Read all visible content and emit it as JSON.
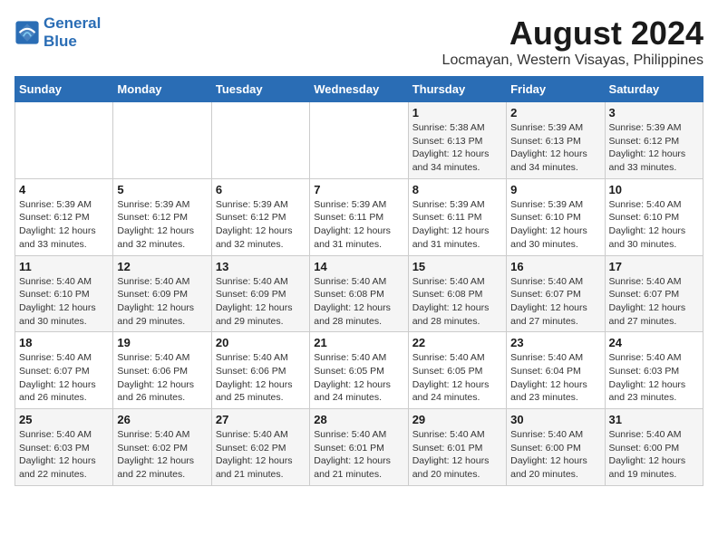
{
  "logo": {
    "line1": "General",
    "line2": "Blue"
  },
  "title": "August 2024",
  "subtitle": "Locmayan, Western Visayas, Philippines",
  "days_of_week": [
    "Sunday",
    "Monday",
    "Tuesday",
    "Wednesday",
    "Thursday",
    "Friday",
    "Saturday"
  ],
  "weeks": [
    [
      {
        "day": "",
        "info": ""
      },
      {
        "day": "",
        "info": ""
      },
      {
        "day": "",
        "info": ""
      },
      {
        "day": "",
        "info": ""
      },
      {
        "day": "1",
        "info": "Sunrise: 5:38 AM\nSunset: 6:13 PM\nDaylight: 12 hours\nand 34 minutes."
      },
      {
        "day": "2",
        "info": "Sunrise: 5:39 AM\nSunset: 6:13 PM\nDaylight: 12 hours\nand 34 minutes."
      },
      {
        "day": "3",
        "info": "Sunrise: 5:39 AM\nSunset: 6:12 PM\nDaylight: 12 hours\nand 33 minutes."
      }
    ],
    [
      {
        "day": "4",
        "info": "Sunrise: 5:39 AM\nSunset: 6:12 PM\nDaylight: 12 hours\nand 33 minutes."
      },
      {
        "day": "5",
        "info": "Sunrise: 5:39 AM\nSunset: 6:12 PM\nDaylight: 12 hours\nand 32 minutes."
      },
      {
        "day": "6",
        "info": "Sunrise: 5:39 AM\nSunset: 6:12 PM\nDaylight: 12 hours\nand 32 minutes."
      },
      {
        "day": "7",
        "info": "Sunrise: 5:39 AM\nSunset: 6:11 PM\nDaylight: 12 hours\nand 31 minutes."
      },
      {
        "day": "8",
        "info": "Sunrise: 5:39 AM\nSunset: 6:11 PM\nDaylight: 12 hours\nand 31 minutes."
      },
      {
        "day": "9",
        "info": "Sunrise: 5:39 AM\nSunset: 6:10 PM\nDaylight: 12 hours\nand 30 minutes."
      },
      {
        "day": "10",
        "info": "Sunrise: 5:40 AM\nSunset: 6:10 PM\nDaylight: 12 hours\nand 30 minutes."
      }
    ],
    [
      {
        "day": "11",
        "info": "Sunrise: 5:40 AM\nSunset: 6:10 PM\nDaylight: 12 hours\nand 30 minutes."
      },
      {
        "day": "12",
        "info": "Sunrise: 5:40 AM\nSunset: 6:09 PM\nDaylight: 12 hours\nand 29 minutes."
      },
      {
        "day": "13",
        "info": "Sunrise: 5:40 AM\nSunset: 6:09 PM\nDaylight: 12 hours\nand 29 minutes."
      },
      {
        "day": "14",
        "info": "Sunrise: 5:40 AM\nSunset: 6:08 PM\nDaylight: 12 hours\nand 28 minutes."
      },
      {
        "day": "15",
        "info": "Sunrise: 5:40 AM\nSunset: 6:08 PM\nDaylight: 12 hours\nand 28 minutes."
      },
      {
        "day": "16",
        "info": "Sunrise: 5:40 AM\nSunset: 6:07 PM\nDaylight: 12 hours\nand 27 minutes."
      },
      {
        "day": "17",
        "info": "Sunrise: 5:40 AM\nSunset: 6:07 PM\nDaylight: 12 hours\nand 27 minutes."
      }
    ],
    [
      {
        "day": "18",
        "info": "Sunrise: 5:40 AM\nSunset: 6:07 PM\nDaylight: 12 hours\nand 26 minutes."
      },
      {
        "day": "19",
        "info": "Sunrise: 5:40 AM\nSunset: 6:06 PM\nDaylight: 12 hours\nand 26 minutes."
      },
      {
        "day": "20",
        "info": "Sunrise: 5:40 AM\nSunset: 6:06 PM\nDaylight: 12 hours\nand 25 minutes."
      },
      {
        "day": "21",
        "info": "Sunrise: 5:40 AM\nSunset: 6:05 PM\nDaylight: 12 hours\nand 24 minutes."
      },
      {
        "day": "22",
        "info": "Sunrise: 5:40 AM\nSunset: 6:05 PM\nDaylight: 12 hours\nand 24 minutes."
      },
      {
        "day": "23",
        "info": "Sunrise: 5:40 AM\nSunset: 6:04 PM\nDaylight: 12 hours\nand 23 minutes."
      },
      {
        "day": "24",
        "info": "Sunrise: 5:40 AM\nSunset: 6:03 PM\nDaylight: 12 hours\nand 23 minutes."
      }
    ],
    [
      {
        "day": "25",
        "info": "Sunrise: 5:40 AM\nSunset: 6:03 PM\nDaylight: 12 hours\nand 22 minutes."
      },
      {
        "day": "26",
        "info": "Sunrise: 5:40 AM\nSunset: 6:02 PM\nDaylight: 12 hours\nand 22 minutes."
      },
      {
        "day": "27",
        "info": "Sunrise: 5:40 AM\nSunset: 6:02 PM\nDaylight: 12 hours\nand 21 minutes."
      },
      {
        "day": "28",
        "info": "Sunrise: 5:40 AM\nSunset: 6:01 PM\nDaylight: 12 hours\nand 21 minutes."
      },
      {
        "day": "29",
        "info": "Sunrise: 5:40 AM\nSunset: 6:01 PM\nDaylight: 12 hours\nand 20 minutes."
      },
      {
        "day": "30",
        "info": "Sunrise: 5:40 AM\nSunset: 6:00 PM\nDaylight: 12 hours\nand 20 minutes."
      },
      {
        "day": "31",
        "info": "Sunrise: 5:40 AM\nSunset: 6:00 PM\nDaylight: 12 hours\nand 19 minutes."
      }
    ]
  ]
}
